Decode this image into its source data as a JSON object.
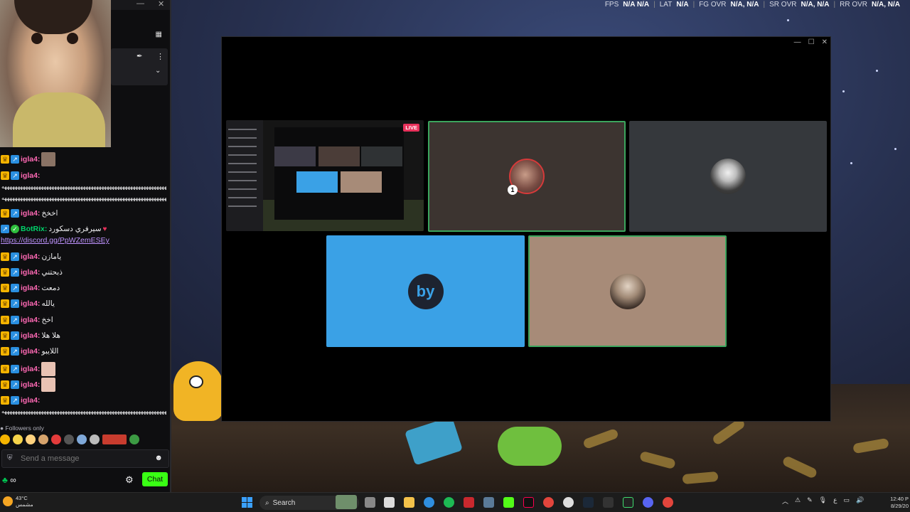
{
  "hud": {
    "fps_label": "FPS",
    "fps_value": "N/A N/A",
    "lat_label": "LAT",
    "lat_value": "N/A",
    "fg_label": "FG OVR",
    "fg_value": "N/A, N/A",
    "sr_label": "SR OVR",
    "sr_value": "N/A, N/A",
    "rr_label": "RR OVR",
    "rr_value": "N/A, N/A"
  },
  "chat": {
    "messages": [
      {
        "user": "igla4:",
        "text": "",
        "emote": true
      },
      {
        "user": "igla4:",
        "text": ""
      },
      {
        "user": "igla4:",
        "text": "اخخخ"
      },
      {
        "user": "BotRix:",
        "text": "سيرفري دسكورد",
        "link": "https://discord.gg/PpWZemESEy"
      },
      {
        "user": "igla4:",
        "text": "يامازن"
      },
      {
        "user": "igla4:",
        "text": "ذبحتني"
      },
      {
        "user": "igla4:",
        "text": "دمعت"
      },
      {
        "user": "igla4:",
        "text": "يالله"
      },
      {
        "user": "igla4:",
        "text": "اخخ"
      },
      {
        "user": "igla4:",
        "text": "هلا هلا"
      },
      {
        "user": "igla4:",
        "text": "اللايبو"
      },
      {
        "user": "igla4:",
        "text": "",
        "emote": true
      },
      {
        "user": "igla4:",
        "text": "",
        "emote": true
      },
      {
        "user": "igla4:",
        "text": ""
      }
    ],
    "spam_line": "ههههههههههههههههههههههههههههههههههههههههههههههههههههههههههههههههههههه",
    "followers_only": "Followers only",
    "send_placeholder": "Send a message",
    "points": "∞",
    "chat_button": "Chat"
  },
  "call": {
    "live_badge": "LIVE",
    "user1_badge": "1",
    "user3_initials": "by"
  },
  "taskbar": {
    "temperature": "43°C",
    "weather_desc": "مشمس",
    "search_label": "Search",
    "lang": "ع",
    "time": "12:40 P",
    "date": "8/29/20"
  },
  "colors": {
    "speaking_border": "#3ba55d",
    "chat_accent": "#39ff14",
    "username": "#ff69b4",
    "bot_username": "#00d26a"
  }
}
